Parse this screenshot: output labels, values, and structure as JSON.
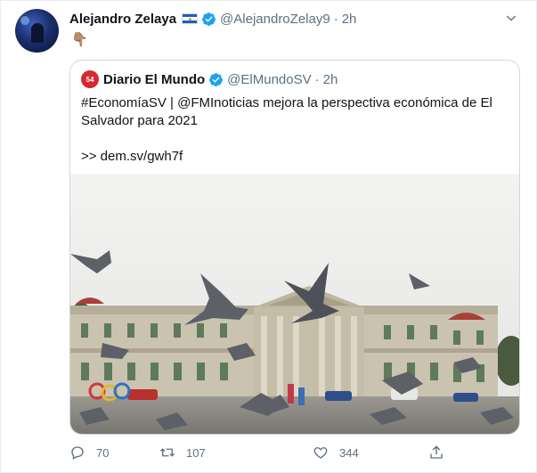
{
  "tweet": {
    "author_name": "Alejandro Zelaya",
    "author_handle": "@AlejandroZelay9",
    "separator": "·",
    "time": "2h",
    "text_emoji": "👇🏽"
  },
  "quoted": {
    "avatar_text": "54",
    "author_name": "Diario El Mundo",
    "author_handle": "@ElMundoSV",
    "separator": "·",
    "time": "2h",
    "text": "#EconomíaSV | @FMInoticias mejora la perspectiva económica de El Salvador para 2021",
    "link_text": ">> dem.sv/gwh7f"
  },
  "actions": {
    "reply_count": "70",
    "retweet_count": "107",
    "like_count": "344"
  },
  "colors": {
    "accent": "#1da1f2",
    "muted": "#5b7083",
    "border": "#cfd9de"
  },
  "icons": [
    "flag-el-salvador-icon",
    "verified-badge-icon",
    "chevron-down-icon",
    "reply-icon",
    "retweet-icon",
    "like-icon",
    "share-icon"
  ]
}
